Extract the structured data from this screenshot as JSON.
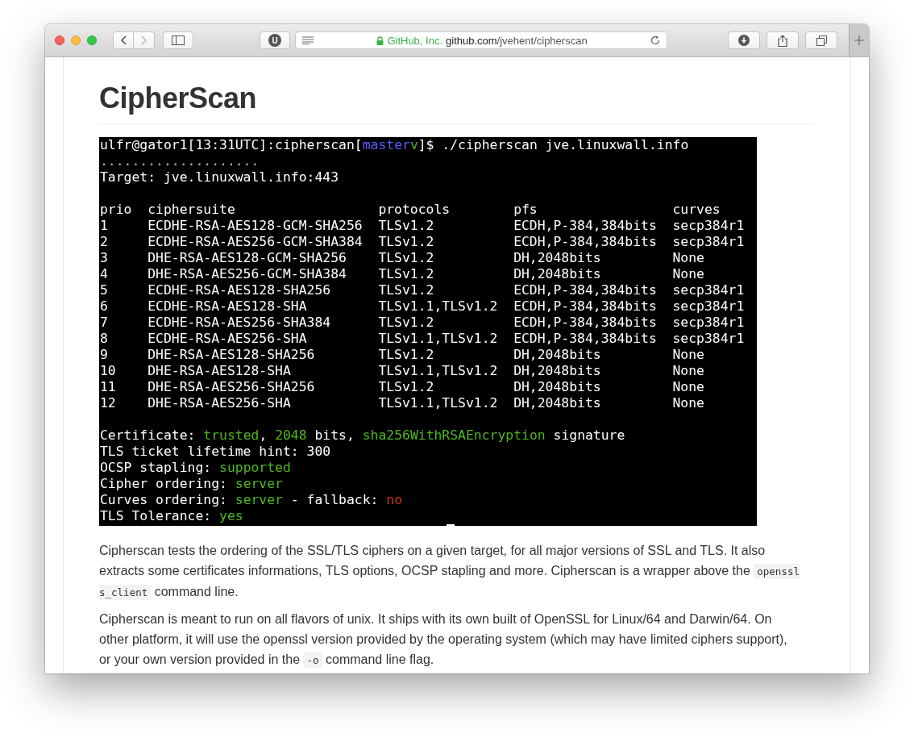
{
  "window": {
    "extension_badge": "U",
    "address_bar": {
      "site_owner": "GitHub, Inc.",
      "domain": "github.com",
      "path": "/jvehent/cipherscan"
    }
  },
  "page": {
    "heading": "CipherScan",
    "terminal": {
      "prompt": [
        {
          "text": "ulfr@gator1[13:31UTC]:cipherscan["
        },
        {
          "text": "master",
          "color": "#5c5cff"
        },
        {
          "text": "v",
          "color": "#4eb81c"
        },
        {
          "text": "]$ ./cipherscan jve.linuxwall.info"
        }
      ],
      "progress": "....................",
      "target": "Target: jve.linuxwall.info:443",
      "columns": [
        "prio",
        "ciphersuite",
        "protocols",
        "pfs",
        "curves"
      ],
      "rows": [
        [
          "1",
          "ECDHE-RSA-AES128-GCM-SHA256",
          "TLSv1.2",
          "ECDH,P-384,384bits",
          "secp384r1"
        ],
        [
          "2",
          "ECDHE-RSA-AES256-GCM-SHA384",
          "TLSv1.2",
          "ECDH,P-384,384bits",
          "secp384r1"
        ],
        [
          "3",
          "DHE-RSA-AES128-GCM-SHA256",
          "TLSv1.2",
          "DH,2048bits",
          "None"
        ],
        [
          "4",
          "DHE-RSA-AES256-GCM-SHA384",
          "TLSv1.2",
          "DH,2048bits",
          "None"
        ],
        [
          "5",
          "ECDHE-RSA-AES128-SHA256",
          "TLSv1.2",
          "ECDH,P-384,384bits",
          "secp384r1"
        ],
        [
          "6",
          "ECDHE-RSA-AES128-SHA",
          "TLSv1.1,TLSv1.2",
          "ECDH,P-384,384bits",
          "secp384r1"
        ],
        [
          "7",
          "ECDHE-RSA-AES256-SHA384",
          "TLSv1.2",
          "ECDH,P-384,384bits",
          "secp384r1"
        ],
        [
          "8",
          "ECDHE-RSA-AES256-SHA",
          "TLSv1.1,TLSv1.2",
          "ECDH,P-384,384bits",
          "secp384r1"
        ],
        [
          "9",
          "DHE-RSA-AES128-SHA256",
          "TLSv1.2",
          "DH,2048bits",
          "None"
        ],
        [
          "10",
          "DHE-RSA-AES128-SHA",
          "TLSv1.1,TLSv1.2",
          "DH,2048bits",
          "None"
        ],
        [
          "11",
          "DHE-RSA-AES256-SHA256",
          "TLSv1.2",
          "DH,2048bits",
          "None"
        ],
        [
          "12",
          "DHE-RSA-AES256-SHA",
          "TLSv1.1,TLSv1.2",
          "DH,2048bits",
          "None"
        ]
      ],
      "summary": [
        [
          {
            "text": "Certificate: ",
            "color": "#ffffff"
          },
          {
            "text": "trusted",
            "color": "#4eb81c"
          },
          {
            "text": ", ",
            "color": "#ffffff"
          },
          {
            "text": "2048",
            "color": "#4eb81c"
          },
          {
            "text": " bits, ",
            "color": "#ffffff"
          },
          {
            "text": "sha256WithRSAEncryption",
            "color": "#4eb81c"
          },
          {
            "text": " signature",
            "color": "#ffffff"
          }
        ],
        [
          {
            "text": "TLS ticket lifetime hint: 300",
            "color": "#ffffff"
          }
        ],
        [
          {
            "text": "OCSP stapling: ",
            "color": "#ffffff"
          },
          {
            "text": "supported",
            "color": "#4eb81c"
          }
        ],
        [
          {
            "text": "Cipher ordering: ",
            "color": "#ffffff"
          },
          {
            "text": "server",
            "color": "#4eb81c"
          }
        ],
        [
          {
            "text": "Curves ordering: ",
            "color": "#ffffff"
          },
          {
            "text": "server",
            "color": "#4eb81c"
          },
          {
            "text": " - fallback: ",
            "color": "#ffffff"
          },
          {
            "text": "no",
            "color": "#c8321e"
          }
        ],
        [
          {
            "text": "TLS Tolerance: ",
            "color": "#ffffff"
          },
          {
            "text": "yes",
            "color": "#4eb81c"
          }
        ]
      ]
    },
    "paragraphs": [
      [
        {
          "kind": "text",
          "text": "Cipherscan tests the ordering of the SSL/TLS ciphers on a given target, for all major versions of SSL and TLS. It also extracts some certificates informations, TLS options, OCSP stapling and more. Cipherscan is a wrapper above the "
        },
        {
          "kind": "code",
          "text": "openssl s_client"
        },
        {
          "kind": "text",
          "text": " command line."
        }
      ],
      [
        {
          "kind": "text",
          "text": "Cipherscan is meant to run on all flavors of unix. It ships with its own built of OpenSSL for Linux/64 and Darwin/64. On other platform, it will use the openssl version provided by the operating system (which may have limited ciphers support), or your own version provided in the "
        },
        {
          "kind": "code",
          "text": "-o"
        },
        {
          "kind": "text",
          "text": " command line flag."
        }
      ]
    ]
  }
}
